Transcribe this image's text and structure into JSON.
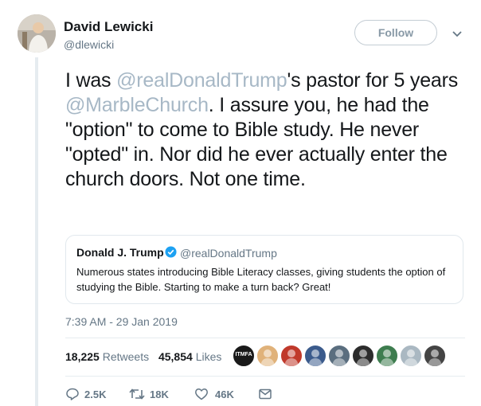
{
  "author": {
    "display_name": "David Lewicki",
    "handle": "@dlewicki",
    "follow_label": "Follow"
  },
  "tweet": {
    "text_part1": "I was ",
    "mention1": "@realDonaldTrump",
    "text_part2": "'s pastor for 5 years ",
    "mention2": "@MarbleChurch",
    "text_part3": ". I assure you, he had the \"option\" to come to Bible study. He never \"opted\" in. Nor did he ever actually enter the church doors. Not one time."
  },
  "quoted_tweet": {
    "display_name": "Donald J. Trump",
    "handle": "@realDonaldTrump",
    "text": "Numerous states introducing Bible Literacy classes, giving students the option of studying the Bible. Starting to make a turn back? Great!"
  },
  "timestamp": "7:39 AM - 29 Jan 2019",
  "stats": {
    "retweets_count": "18,225",
    "retweets_label": "Retweets",
    "likes_count": "45,854",
    "likes_label": "Likes"
  },
  "likers": [
    {
      "label": "ITMFA",
      "color": "#1a1a1a"
    },
    {
      "label": "",
      "color": "#e0b27a"
    },
    {
      "label": "",
      "color": "#c0392b"
    },
    {
      "label": "",
      "color": "#3b5b8c"
    },
    {
      "label": "",
      "color": "#5a6e7f"
    },
    {
      "label": "",
      "color": "#2c2c2c"
    },
    {
      "label": "",
      "color": "#3e7d4f"
    },
    {
      "label": "",
      "color": "#aab8c2"
    },
    {
      "label": "",
      "color": "#444444"
    }
  ],
  "actions": {
    "reply_count": "2.5K",
    "retweet_count": "18K",
    "like_count": "46K"
  },
  "colors": {
    "link": "#a7b8c6",
    "secondary": "#657786",
    "verified": "#1da1f2"
  }
}
